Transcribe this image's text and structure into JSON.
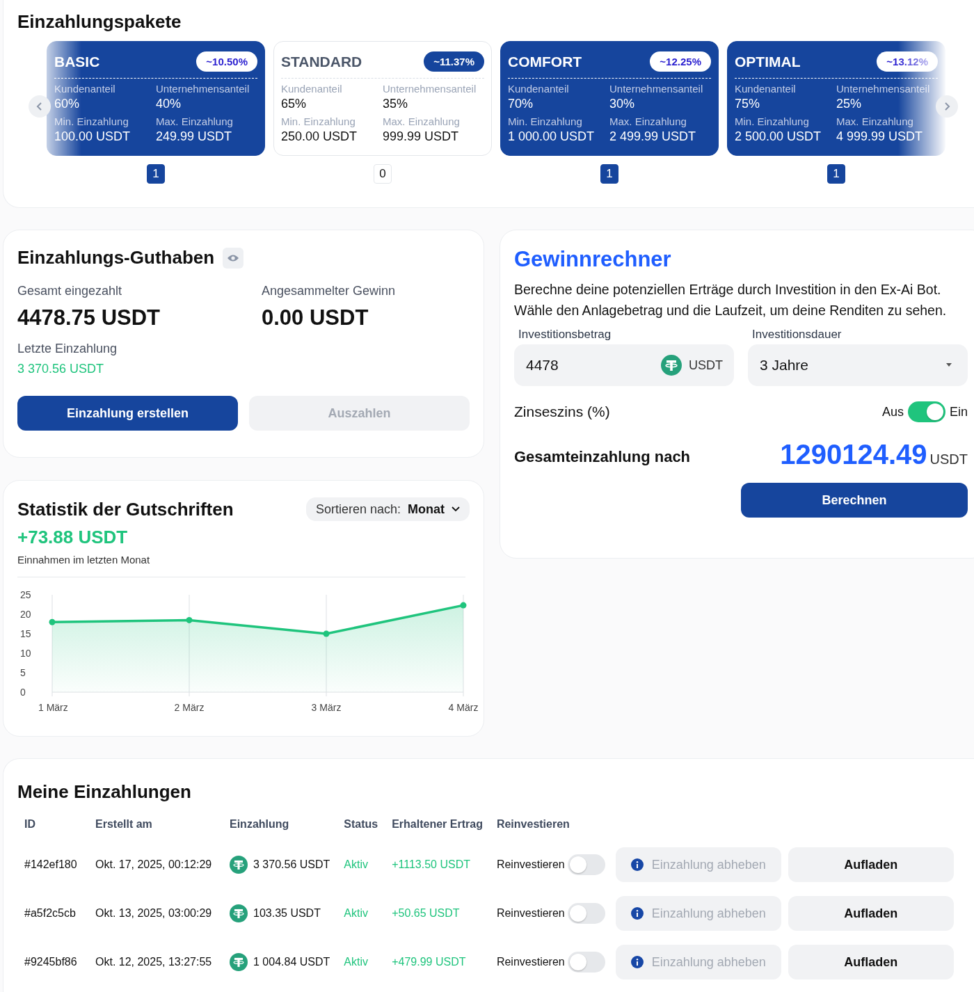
{
  "packages": {
    "title": "Einzahlungspakete",
    "items": [
      {
        "name": "BASIC",
        "rate": "~10.50%",
        "active": true,
        "count": "1",
        "fields": [
          {
            "label": "Kundenanteil",
            "value": "60%"
          },
          {
            "label": "Unternehmensanteil",
            "value": "40%"
          },
          {
            "label": "Min. Einzahlung",
            "value": "100.00 USDT"
          },
          {
            "label": "Max. Einzahlung",
            "value": "249.99 USDT"
          }
        ]
      },
      {
        "name": "STANDARD",
        "rate": "~11.37%",
        "active": false,
        "count": "0",
        "fields": [
          {
            "label": "Kundenanteil",
            "value": "65%"
          },
          {
            "label": "Unternehmensanteil",
            "value": "35%"
          },
          {
            "label": "Min. Einzahlung",
            "value": "250.00 USDT"
          },
          {
            "label": "Max. Einzahlung",
            "value": "999.99 USDT"
          }
        ]
      },
      {
        "name": "COMFORT",
        "rate": "~12.25%",
        "active": true,
        "count": "1",
        "fields": [
          {
            "label": "Kundenanteil",
            "value": "70%"
          },
          {
            "label": "Unternehmensanteil",
            "value": "30%"
          },
          {
            "label": "Min. Einzahlung",
            "value": "1 000.00 USDT"
          },
          {
            "label": "Max. Einzahlung",
            "value": "2 499.99 USDT"
          }
        ]
      },
      {
        "name": "OPTIMAL",
        "rate": "~13.12%",
        "active": true,
        "count": "1",
        "fields": [
          {
            "label": "Kundenanteil",
            "value": "75%"
          },
          {
            "label": "Unternehmensanteil",
            "value": "25%"
          },
          {
            "label": "Min. Einzahlung",
            "value": "2 500.00 USDT"
          },
          {
            "label": "Max. Einzahlung",
            "value": "4 999.99 USDT"
          }
        ]
      }
    ]
  },
  "balance": {
    "title": "Einzahlungs-Guthaben",
    "stats": [
      {
        "label": "Gesamt eingezahlt",
        "value": "4478.75 USDT"
      },
      {
        "label": "Angesammelter Gewinn",
        "value": "0.00 USDT"
      }
    ],
    "last_label": "Letzte Einzahlung",
    "last_value": "3 370.56 USDT",
    "buttons": [
      {
        "label": "Einzahlung erstellen",
        "disabled": false
      },
      {
        "label": "Auszahlen",
        "disabled": true
      }
    ]
  },
  "statistics": {
    "title": "Statistik der Gutschriften",
    "sort_label": "Sortieren nach:",
    "sort_value": "Monat",
    "amount": "+73.88 USDT",
    "caption": "Einnahmen im letzten Monat",
    "chart_data": {
      "type": "area",
      "categories": [
        "1 März",
        "2 März",
        "3 März",
        "4 März"
      ],
      "series": [
        {
          "color": "#1fc47d",
          "values": [
            18,
            18.5,
            15,
            22.3
          ]
        }
      ],
      "ylim": [
        0,
        25
      ],
      "yticks": [
        0,
        5,
        10,
        15,
        20,
        25
      ]
    }
  },
  "calculator": {
    "title": "Gewinnrechner",
    "description": "Berechne deine potenziellen Erträge durch Investition in den Ex-Ai Bot. Wähle den Anlagebetrag und die Laufzeit, um deine Renditen zu sehen.",
    "amount_label": "Investitionsbetrag",
    "amount_value": "4478",
    "currency": "USDT",
    "duration_label": "Investitionsdauer",
    "duration_value": "3 Jahre",
    "compound_label": "Zinseszins (%)",
    "off_label": "Aus",
    "on_label": "Ein",
    "compound": true,
    "result_label": "Gesamteinzahlung nach",
    "result_value": "1290124.49",
    "result_unit": "USDT",
    "button": "Berechnen"
  },
  "deposits": {
    "title": "Meine Einzahlungen",
    "columns": [
      "ID",
      "Erstellt am",
      "Einzahlung",
      "Status",
      "Erhaltener Ertrag",
      "Reinvestieren"
    ],
    "rows": [
      {
        "id": "#142ef180",
        "created": "Okt. 17, 2025, 00:12:29",
        "amount": "3 370.56 USDT",
        "status": "Aktiv",
        "income": "+1113.50 USDT",
        "reinvest_label": "Reinvestieren",
        "reinvest": false,
        "withdraw": "Einzahlung abheben",
        "withdraw_disabled": true,
        "topup": "Aufladen"
      },
      {
        "id": "#a5f2c5cb",
        "created": "Okt. 13, 2025, 03:00:29",
        "amount": "103.35 USDT",
        "status": "Aktiv",
        "income": "+50.65 USDT",
        "reinvest_label": "Reinvestieren",
        "reinvest": false,
        "withdraw": "Einzahlung abheben",
        "withdraw_disabled": true,
        "topup": "Aufladen"
      },
      {
        "id": "#9245bf86",
        "created": "Okt. 12, 2025, 13:27:55",
        "amount": "1 004.84 USDT",
        "status": "Aktiv",
        "income": "+479.99 USDT",
        "reinvest_label": "Reinvestieren",
        "reinvest": false,
        "withdraw": "Einzahlung abheben",
        "withdraw_disabled": true,
        "topup": "Aufladen"
      }
    ]
  }
}
